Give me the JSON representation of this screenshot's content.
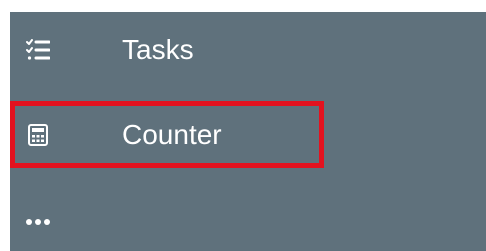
{
  "sidebar": {
    "items": [
      {
        "label": "Tasks",
        "icon": "task-list-icon"
      },
      {
        "label": "Counter",
        "icon": "calculator-icon",
        "highlighted": true
      },
      {
        "label": "",
        "icon": "more-icon"
      }
    ]
  },
  "colors": {
    "sidebar_background": "#5f717c",
    "text": "#ffffff",
    "highlight_border": "#e3121f"
  }
}
